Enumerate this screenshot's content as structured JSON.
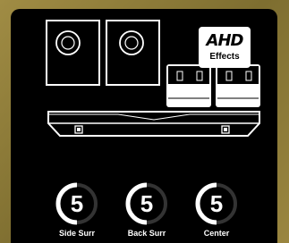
{
  "effects_badge": {
    "logo": "AHD",
    "label": "Effects"
  },
  "channels": [
    {
      "label": "Side Surr",
      "value": "5",
      "level": 0.5
    },
    {
      "label": "Back Surr",
      "value": "5",
      "level": 0.5
    },
    {
      "label": "Center",
      "value": "5",
      "level": 0.5
    }
  ],
  "colors": {
    "background": "#000000",
    "foreground": "#ffffff",
    "frame": "#8a7a3a"
  }
}
